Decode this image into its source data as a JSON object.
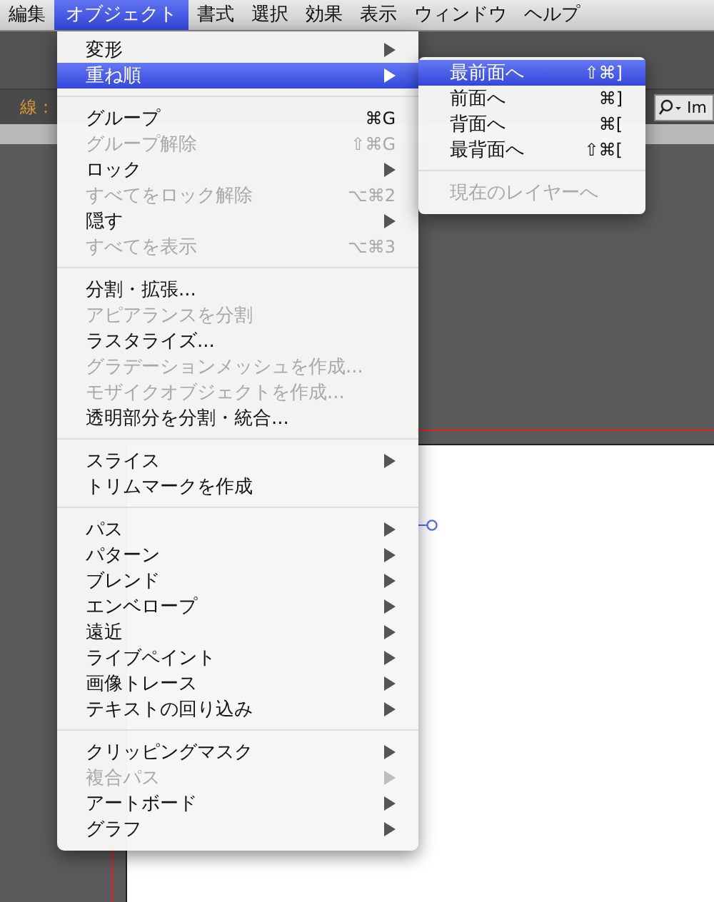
{
  "menubar": [
    {
      "label": "編集",
      "selected": false
    },
    {
      "label": "オブジェクト",
      "selected": true
    },
    {
      "label": "書式",
      "selected": false
    },
    {
      "label": "選択",
      "selected": false
    },
    {
      "label": "効果",
      "selected": false
    },
    {
      "label": "表示",
      "selected": false
    },
    {
      "label": "ウィンドウ",
      "selected": false
    },
    {
      "label": "ヘルプ",
      "selected": false
    }
  ],
  "control_bar": {
    "stroke_label": "線：",
    "search": {
      "value": "Im"
    }
  },
  "menu": {
    "groups": [
      [
        {
          "label": "変形",
          "submenu": true,
          "disabled": false,
          "selected": false
        },
        {
          "label": "重ね順",
          "submenu": true,
          "disabled": false,
          "selected": true
        }
      ],
      [
        {
          "label": "グループ",
          "shortcut": "⌘G",
          "submenu": false,
          "disabled": false,
          "selected": false
        },
        {
          "label": "グループ解除",
          "shortcut": "⇧⌘G",
          "submenu": false,
          "disabled": true,
          "selected": false
        },
        {
          "label": "ロック",
          "submenu": true,
          "disabled": false,
          "selected": false
        },
        {
          "label": "すべてをロック解除",
          "shortcut": "⌥⌘2",
          "submenu": false,
          "disabled": true,
          "selected": false
        },
        {
          "label": "隠す",
          "submenu": true,
          "disabled": false,
          "selected": false
        },
        {
          "label": "すべてを表示",
          "shortcut": "⌥⌘3",
          "submenu": false,
          "disabled": true,
          "selected": false
        }
      ],
      [
        {
          "label": "分割・拡張...",
          "submenu": false,
          "disabled": false,
          "selected": false
        },
        {
          "label": "アピアランスを分割",
          "submenu": false,
          "disabled": true,
          "selected": false
        },
        {
          "label": "ラスタライズ...",
          "submenu": false,
          "disabled": false,
          "selected": false
        },
        {
          "label": "グラデーションメッシュを作成...",
          "submenu": false,
          "disabled": true,
          "selected": false
        },
        {
          "label": "モザイクオブジェクトを作成...",
          "submenu": false,
          "disabled": true,
          "selected": false
        },
        {
          "label": "透明部分を分割・統合...",
          "submenu": false,
          "disabled": false,
          "selected": false
        }
      ],
      [
        {
          "label": "スライス",
          "submenu": true,
          "disabled": false,
          "selected": false
        },
        {
          "label": "トリムマークを作成",
          "submenu": false,
          "disabled": false,
          "selected": false
        }
      ],
      [
        {
          "label": "パス",
          "submenu": true,
          "disabled": false,
          "selected": false
        },
        {
          "label": "パターン",
          "submenu": true,
          "disabled": false,
          "selected": false
        },
        {
          "label": "ブレンド",
          "submenu": true,
          "disabled": false,
          "selected": false
        },
        {
          "label": "エンベロープ",
          "submenu": true,
          "disabled": false,
          "selected": false
        },
        {
          "label": "遠近",
          "submenu": true,
          "disabled": false,
          "selected": false
        },
        {
          "label": "ライブペイント",
          "submenu": true,
          "disabled": false,
          "selected": false
        },
        {
          "label": "画像トレース",
          "submenu": true,
          "disabled": false,
          "selected": false
        },
        {
          "label": "テキストの回り込み",
          "submenu": true,
          "disabled": false,
          "selected": false
        }
      ],
      [
        {
          "label": "クリッピングマスク",
          "submenu": true,
          "disabled": false,
          "selected": false
        },
        {
          "label": "複合パス",
          "submenu": true,
          "disabled": true,
          "selected": false
        },
        {
          "label": "アートボード",
          "submenu": true,
          "disabled": false,
          "selected": false
        },
        {
          "label": "グラフ",
          "submenu": true,
          "disabled": false,
          "selected": false
        }
      ]
    ]
  },
  "submenu": {
    "groups": [
      [
        {
          "label": "最前面へ",
          "shortcut": "⇧⌘]",
          "disabled": false,
          "selected": true
        },
        {
          "label": "前面へ",
          "shortcut": "⌘]",
          "disabled": false,
          "selected": false
        },
        {
          "label": "背面へ",
          "shortcut": "⌘[",
          "disabled": false,
          "selected": false
        },
        {
          "label": "最背面へ",
          "shortcut": "⇧⌘[",
          "disabled": false,
          "selected": false
        }
      ],
      [
        {
          "label": "現在のレイヤーへ",
          "disabled": true,
          "selected": false
        }
      ]
    ]
  }
}
